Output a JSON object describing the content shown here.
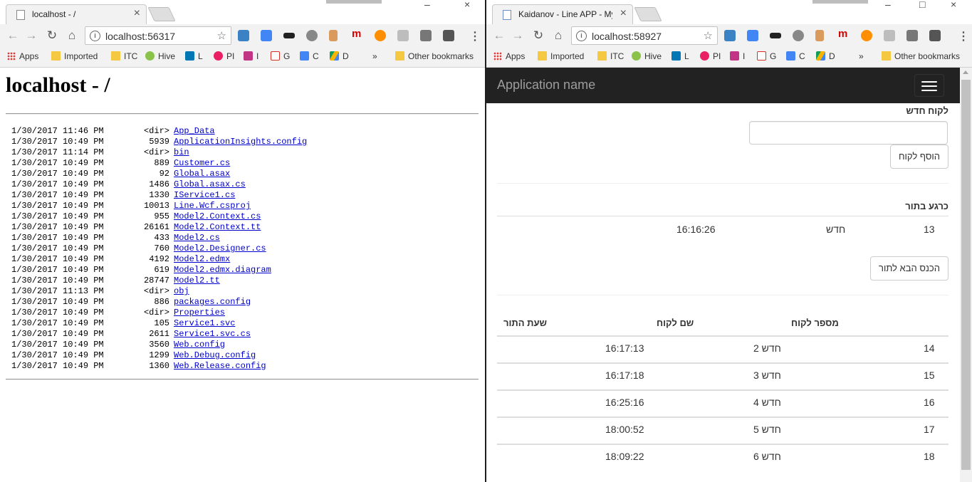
{
  "left_window": {
    "tab_title": "localhost - /",
    "url": "localhost:56317",
    "bookmarks": [
      "Apps",
      "Imported",
      "ITC",
      "Hive",
      "L",
      "PI",
      "I",
      "G",
      "C",
      "D",
      "»",
      "Other bookmarks"
    ],
    "page": {
      "heading": "localhost - /",
      "entries": [
        {
          "date": "1/30/2017 11:46 PM",
          "size": "<dir>",
          "name": "App_Data"
        },
        {
          "date": "1/30/2017 10:49 PM",
          "size": "5939",
          "name": "ApplicationInsights.config"
        },
        {
          "date": "1/30/2017 11:14 PM",
          "size": "<dir>",
          "name": "bin"
        },
        {
          "date": "1/30/2017 10:49 PM",
          "size": "889",
          "name": "Customer.cs"
        },
        {
          "date": "1/30/2017 10:49 PM",
          "size": "92",
          "name": "Global.asax"
        },
        {
          "date": "1/30/2017 10:49 PM",
          "size": "1486",
          "name": "Global.asax.cs"
        },
        {
          "date": "1/30/2017 10:49 PM",
          "size": "1330",
          "name": "IService1.cs"
        },
        {
          "date": "1/30/2017 10:49 PM",
          "size": "10013",
          "name": "Line.Wcf.csproj"
        },
        {
          "date": "1/30/2017 10:49 PM",
          "size": "955",
          "name": "Model2.Context.cs"
        },
        {
          "date": "1/30/2017 10:49 PM",
          "size": "26161",
          "name": "Model2.Context.tt"
        },
        {
          "date": "1/30/2017 10:49 PM",
          "size": "433",
          "name": "Model2.cs"
        },
        {
          "date": "1/30/2017 10:49 PM",
          "size": "760",
          "name": "Model2.Designer.cs"
        },
        {
          "date": "1/30/2017 10:49 PM",
          "size": "4192",
          "name": "Model2.edmx"
        },
        {
          "date": "1/30/2017 10:49 PM",
          "size": "619",
          "name": "Model2.edmx.diagram"
        },
        {
          "date": "1/30/2017 10:49 PM",
          "size": "28747",
          "name": "Model2.tt"
        },
        {
          "date": "1/30/2017 11:13 PM",
          "size": "<dir>",
          "name": "obj"
        },
        {
          "date": "1/30/2017 10:49 PM",
          "size": "886",
          "name": "packages.config"
        },
        {
          "date": "1/30/2017 10:49 PM",
          "size": "<dir>",
          "name": "Properties"
        },
        {
          "date": "1/30/2017 10:49 PM",
          "size": "105",
          "name": "Service1.svc"
        },
        {
          "date": "1/30/2017 10:49 PM",
          "size": "2611",
          "name": "Service1.svc.cs"
        },
        {
          "date": "1/30/2017 10:49 PM",
          "size": "3560",
          "name": "Web.config"
        },
        {
          "date": "1/30/2017 10:49 PM",
          "size": "1299",
          "name": "Web.Debug.config"
        },
        {
          "date": "1/30/2017 10:49 PM",
          "size": "1360",
          "name": "Web.Release.config"
        }
      ]
    }
  },
  "right_window": {
    "tab_title": "Kaidanov - Line APP - My",
    "url": "localhost:58927",
    "bookmarks": [
      "Apps",
      "Imported",
      "ITC",
      "Hive",
      "L",
      "PI",
      "I",
      "G",
      "C",
      "D",
      "»",
      "Other bookmarks"
    ],
    "app": {
      "brand": "Application name",
      "new_customer_label": "לקוח חדש",
      "new_customer_input_value": "",
      "add_customer_button": "הוסף לקוח",
      "now_in_queue_label": "כרגע בתור",
      "current": {
        "number": "13",
        "name": "חדש",
        "time": "16:16:26"
      },
      "next_button": "הכנס הבא לתור",
      "table": {
        "headers": [
          "מספר לקוח",
          "שם לקוח",
          "שעת התור"
        ],
        "rows": [
          {
            "number": "14",
            "name": "חדש 2",
            "time": "16:17:13"
          },
          {
            "number": "15",
            "name": "חדש 3",
            "time": "16:17:18"
          },
          {
            "number": "16",
            "name": "חדש 4",
            "time": "16:25:16"
          },
          {
            "number": "17",
            "name": "חדש 5",
            "time": "18:00:52"
          },
          {
            "number": "18",
            "name": "חדש 6",
            "time": "18:09:22"
          }
        ]
      }
    }
  }
}
